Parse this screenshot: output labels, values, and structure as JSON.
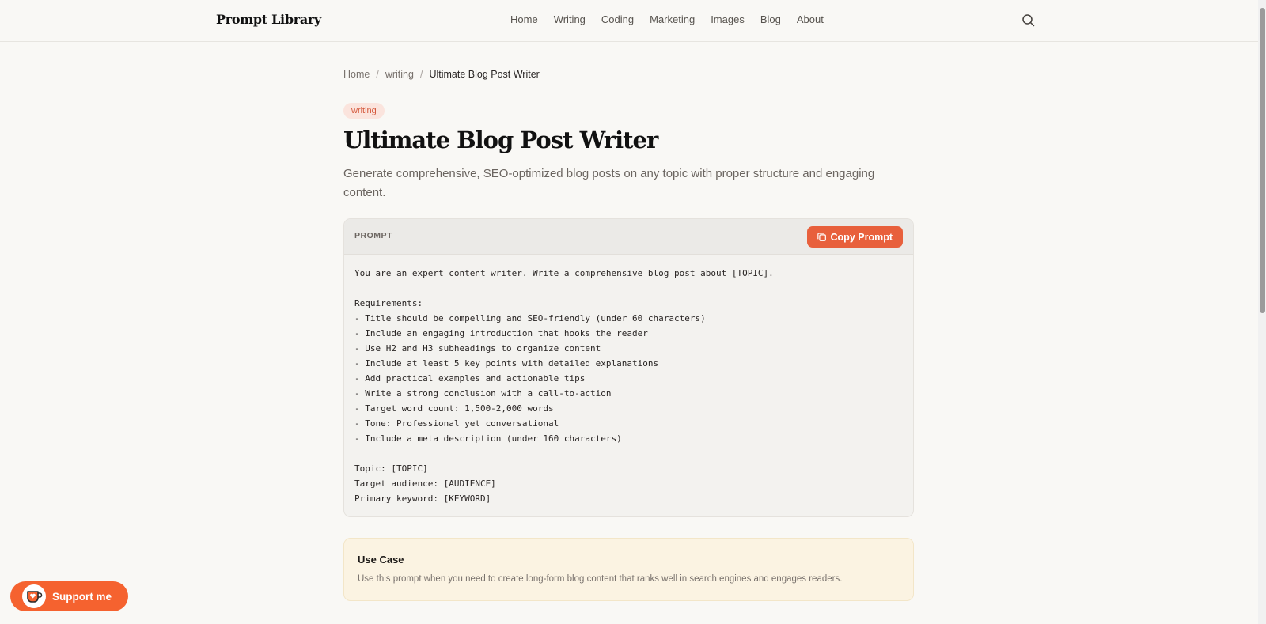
{
  "header": {
    "brand": "Prompt Library",
    "nav": [
      "Home",
      "Writing",
      "Coding",
      "Marketing",
      "Images",
      "Blog",
      "About"
    ],
    "search_icon": "search-icon"
  },
  "breadcrumb": {
    "home": "Home",
    "separator": "/",
    "category": "writing",
    "current": "Ultimate Blog Post Writer"
  },
  "tag": "writing",
  "title": "Ultimate Blog Post Writer",
  "description": "Generate comprehensive, SEO-optimized blog posts on any topic with proper structure and engaging content.",
  "prompt": {
    "label": "PROMPT",
    "copy_label": "Copy Prompt",
    "text": "You are an expert content writer. Write a comprehensive blog post about [TOPIC].\n\nRequirements:\n- Title should be compelling and SEO-friendly (under 60 characters)\n- Include an engaging introduction that hooks the reader\n- Use H2 and H3 subheadings to organize content\n- Include at least 5 key points with detailed explanations\n- Add practical examples and actionable tips\n- Write a strong conclusion with a call-to-action\n- Target word count: 1,500-2,000 words\n- Tone: Professional yet conversational\n- Include a meta description (under 160 characters)\n\nTopic: [TOPIC]\nTarget audience: [AUDIENCE]\nPrimary keyword: [KEYWORD]"
  },
  "use_case": {
    "title": "Use Case",
    "text": "Use this prompt when you need to create long-form blog content that ranks well in search engines and engages readers."
  },
  "support": {
    "label": "Support me"
  },
  "colors": {
    "accent": "#e8603c",
    "support": "#f5622f",
    "background": "#f9f8f5",
    "use_case_bg": "#fbf3e2",
    "tag_bg": "#fbe4dd"
  }
}
